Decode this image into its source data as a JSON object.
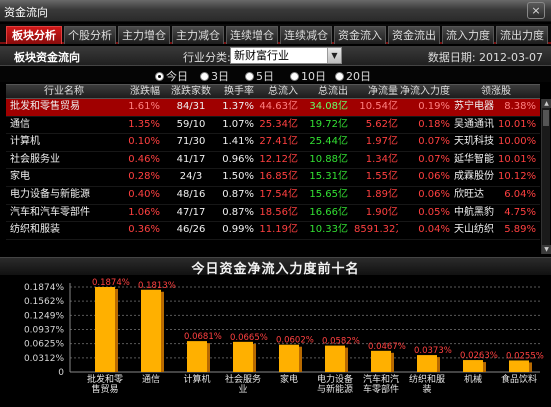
{
  "window": {
    "title": "资金流向",
    "close_label": "×"
  },
  "tabs": [
    {
      "label": "板块分析",
      "active": true
    },
    {
      "label": "个股分析"
    },
    {
      "label": "主力增仓"
    },
    {
      "label": "主力减仓"
    },
    {
      "label": "连续增仓"
    },
    {
      "label": "连续减仓"
    },
    {
      "label": "资金流入"
    },
    {
      "label": "资金流出"
    },
    {
      "label": "流入力度"
    },
    {
      "label": "流出力度"
    }
  ],
  "toolbar": {
    "section_title": "板块资金流向",
    "category_label": "行业分类:",
    "category_value": "新财富行业",
    "date_text": "数据日期: 2012-03-07"
  },
  "periods": [
    {
      "label": "今日",
      "selected": true
    },
    {
      "label": "3日"
    },
    {
      "label": "5日"
    },
    {
      "label": "10日"
    },
    {
      "label": "20日"
    }
  ],
  "table": {
    "columns": [
      "行业名称",
      "涨跌幅",
      "涨跌家数",
      "换手率",
      "总流入",
      "总流出",
      "净流量",
      "净流入力度▼",
      "领涨股"
    ],
    "rows": [
      [
        "批发和零售贸易",
        "1.61%",
        "84/31",
        "1.37%",
        "44.63亿",
        "34.08亿",
        "10.54亿",
        "0.19%",
        "苏宁电器",
        "8.38%"
      ],
      [
        "通信",
        "1.35%",
        "59/10",
        "1.07%",
        "25.34亿",
        "19.72亿",
        "5.62亿",
        "0.18%",
        "吴通通讯",
        "10.01%"
      ],
      [
        "计算机",
        "0.10%",
        "71/30",
        "1.41%",
        "27.41亿",
        "25.44亿",
        "1.97亿",
        "0.07%",
        "天玑科技",
        "10.00%"
      ],
      [
        "社会服务业",
        "0.46%",
        "41/17",
        "0.96%",
        "12.12亿",
        "10.88亿",
        "1.34亿",
        "0.07%",
        "延华智能",
        "10.01%"
      ],
      [
        "家电",
        "0.28%",
        "24/3",
        "1.50%",
        "16.85亿",
        "15.31亿",
        "1.55亿",
        "0.06%",
        "成霖股份",
        "10.12%"
      ],
      [
        "电力设备与新能源",
        "0.40%",
        "48/16",
        "0.87%",
        "17.54亿",
        "15.65亿",
        "1.89亿",
        "0.06%",
        "欣旺达",
        "6.04%"
      ],
      [
        "汽车和汽车零部件",
        "1.06%",
        "47/17",
        "0.87%",
        "18.56亿",
        "16.66亿",
        "1.90亿",
        "0.05%",
        "中航黑豹",
        "4.75%"
      ],
      [
        "纺织和服装",
        "0.36%",
        "46/26",
        "0.99%",
        "11.19亿",
        "10.33亿",
        "8591.32万",
        "0.04%",
        "天山纺织",
        "5.89%"
      ]
    ]
  },
  "chart_data": {
    "type": "bar",
    "title": "今日资金净流入力度前十名",
    "categories": [
      "批发和零售贸易",
      "通信",
      "计算机",
      "社会服务业",
      "家电",
      "电力设备与新能源",
      "汽车和汽车零部件",
      "纺织和服装",
      "机械",
      "食品饮料"
    ],
    "category_labels": [
      [
        "批发和零",
        "售贸易"
      ],
      [
        "通信"
      ],
      [
        "计算机"
      ],
      [
        "社会服务",
        "业"
      ],
      [
        "家电"
      ],
      [
        "电力设备",
        "与新能源"
      ],
      [
        "汽车和汽",
        "车零部件"
      ],
      [
        "纺织和服",
        "装"
      ],
      [
        "机械"
      ],
      [
        "食品饮料"
      ]
    ],
    "values": [
      0.1874,
      0.1813,
      0.0681,
      0.0665,
      0.0602,
      0.0582,
      0.0467,
      0.0373,
      0.0263,
      0.0255
    ],
    "value_labels": [
      "0.1874%",
      "0.1813%",
      "0.0681%",
      "0.0665%",
      "0.0602%",
      "0.0582%",
      "0.0467%",
      "0.0373%",
      "0.0263%",
      "0.0255%"
    ],
    "y_ticks": [
      "0.1874%",
      "0.1562%",
      "0.1249%",
      "0.0937%",
      "0.0625%",
      "0.0312%",
      "0"
    ],
    "ylim": [
      0,
      0.1874
    ],
    "grid": true,
    "bar_color": "#ffb000",
    "label_color": "#ff4040"
  }
}
